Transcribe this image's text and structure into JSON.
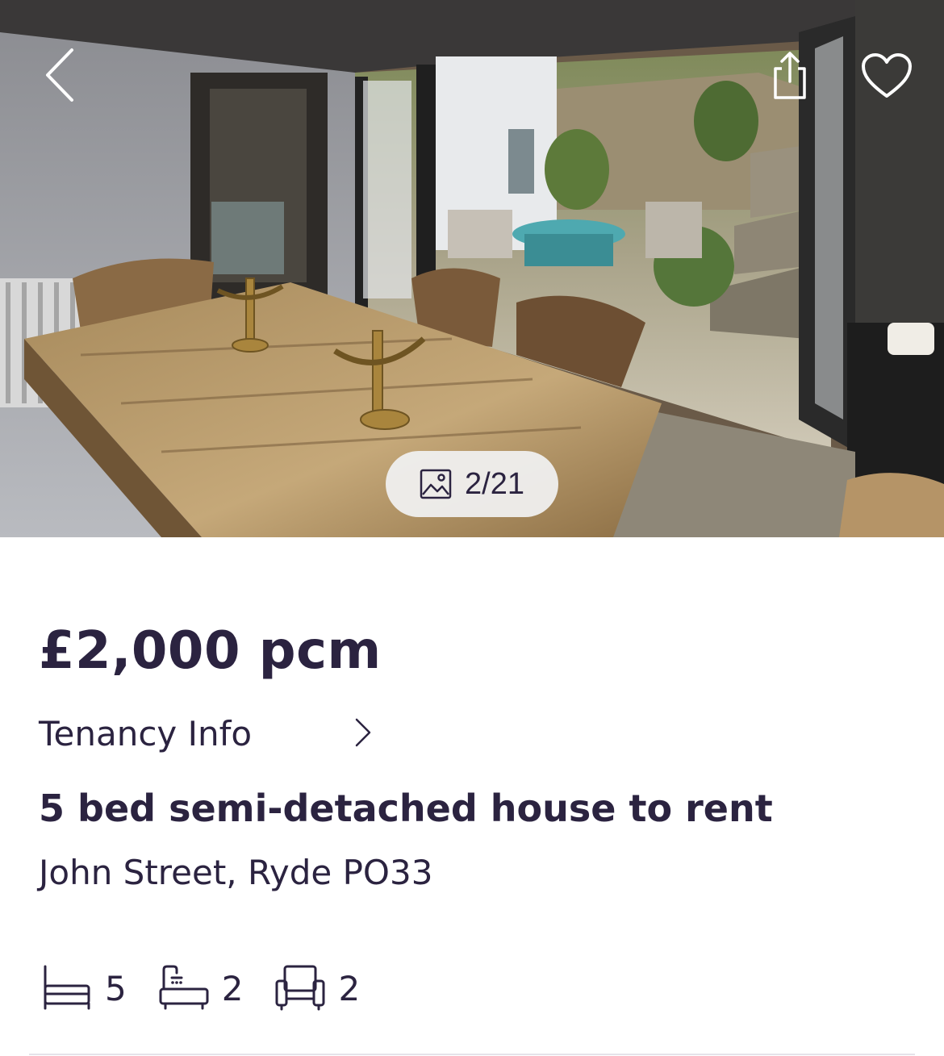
{
  "gallery": {
    "counter": "2/21",
    "icons": {
      "back": "chevron-left-icon",
      "share": "share-icon",
      "favourite": "heart-icon",
      "photos": "image-icon"
    }
  },
  "listing": {
    "price": "£2,000 pcm",
    "tenancy_label": "Tenancy Info",
    "title": "5 bed semi-detached house to rent",
    "address": "John Street, Ryde PO33",
    "features": {
      "bedrooms": "5",
      "bathrooms": "2",
      "receptions": "2"
    }
  },
  "colors": {
    "text": "#2b2340",
    "counter_bg": "#f0f0f0",
    "divider": "#e5e3ea"
  }
}
